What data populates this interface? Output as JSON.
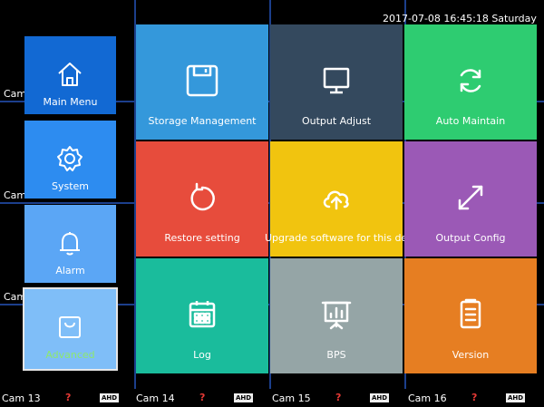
{
  "datetime": "2017-07-08 16:45:18  Saturday",
  "cameras": {
    "left_labels": [
      "Cam",
      "Cam",
      "Cam"
    ],
    "bottom": [
      {
        "name": "Cam 13",
        "status_icon": "?",
        "badge": "AHD"
      },
      {
        "name": "Cam 14",
        "status_icon": "?",
        "badge": "AHD"
      },
      {
        "name": "Cam 15",
        "status_icon": "?",
        "badge": "AHD"
      },
      {
        "name": "Cam 16",
        "status_icon": "?",
        "badge": "AHD"
      }
    ]
  },
  "side_menu": [
    {
      "label": "Main Menu",
      "icon": "home-icon",
      "color": "#1269d3"
    },
    {
      "label": "System",
      "icon": "gear-icon",
      "color": "#2d8cf0"
    },
    {
      "label": "Alarm",
      "icon": "bell-icon",
      "color": "#5ba6f5"
    },
    {
      "label": "Advanced",
      "icon": "bag-icon",
      "color": "#7fbef8",
      "selected": true
    }
  ],
  "tiles": [
    {
      "label": "Storage Management",
      "icon": "floppy-disk-icon",
      "color": "#3498db"
    },
    {
      "label": "Output Adjust",
      "icon": "monitor-icon",
      "color": "#34495e"
    },
    {
      "label": "Auto Maintain",
      "icon": "refresh-icon",
      "color": "#2ecc71"
    },
    {
      "label": "Restore setting",
      "icon": "restore-icon",
      "color": "#e74c3c"
    },
    {
      "label": "Upgrade software for this device",
      "icon": "cloud-upload-icon",
      "color": "#f1c40f"
    },
    {
      "label": "Output Config",
      "icon": "expand-arrows-icon",
      "color": "#9b59b6"
    },
    {
      "label": "Log",
      "icon": "calendar-icon",
      "color": "#1abc9c"
    },
    {
      "label": "BPS",
      "icon": "presentation-chart-icon",
      "color": "#95a5a6"
    },
    {
      "label": "Version",
      "icon": "document-list-icon",
      "color": "#e67e22"
    }
  ]
}
